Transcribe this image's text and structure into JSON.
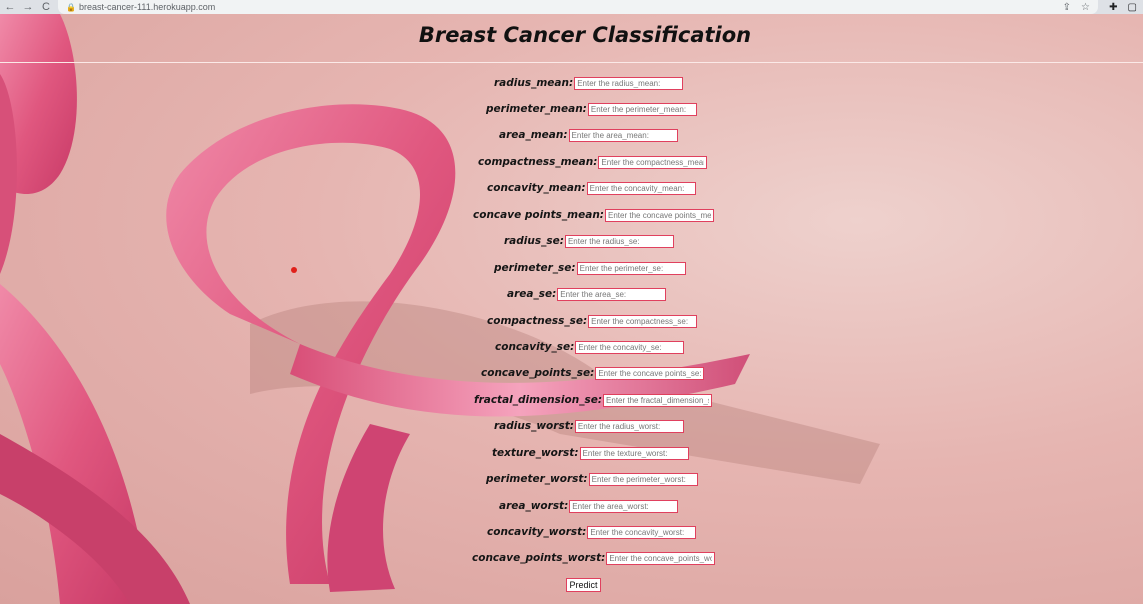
{
  "browser": {
    "url": "breast-cancer-111.herokuapp.com",
    "icons": {
      "back": "←",
      "forward": "→",
      "reload": "C",
      "lock": "🔒",
      "share": "⇪",
      "star": "☆",
      "extensions": "✚",
      "sidepanel": "▢"
    }
  },
  "page": {
    "title": "Breast Cancer Classification",
    "predict_label": "Predict",
    "fields": [
      {
        "label": "radius_mean:",
        "placeholder": "Enter the radius_mean:"
      },
      {
        "label": "perimeter_mean:",
        "placeholder": "Enter the perimeter_mean:"
      },
      {
        "label": "area_mean:",
        "placeholder": "Enter the area_mean:"
      },
      {
        "label": "compactness_mean:",
        "placeholder": "Enter the compactness_mean:"
      },
      {
        "label": "concavity_mean:",
        "placeholder": "Enter the concavity_mean:"
      },
      {
        "label": "concave points_mean:",
        "placeholder": "Enter the concave points_mean:"
      },
      {
        "label": "radius_se:",
        "placeholder": "Enter the radius_se:"
      },
      {
        "label": "perimeter_se:",
        "placeholder": "Enter the perimeter_se:"
      },
      {
        "label": "area_se:",
        "placeholder": "Enter the area_se:"
      },
      {
        "label": "compactness_se:",
        "placeholder": "Enter the compactness_se:"
      },
      {
        "label": "concavity_se:",
        "placeholder": "Enter the concavity_se:"
      },
      {
        "label": "concave_points_se:",
        "placeholder": "Enter the concave points_se:"
      },
      {
        "label": "fractal_dimension_se:",
        "placeholder": "Enter the fractal_dimension_se:"
      },
      {
        "label": "radius_worst:",
        "placeholder": "Enter the radius_worst:"
      },
      {
        "label": "texture_worst:",
        "placeholder": "Enter the texture_worst:"
      },
      {
        "label": "perimeter_worst:",
        "placeholder": "Enter the perimeter_worst:"
      },
      {
        "label": "area_worst:",
        "placeholder": "Enter the area_worst:"
      },
      {
        "label": "concavity_worst:",
        "placeholder": "Enter the concavity_worst:"
      },
      {
        "label": "concave_points_worst:",
        "placeholder": "Enter the concave_points_worst:"
      }
    ]
  },
  "colors": {
    "accent": "#e0405e",
    "ribbon": "#e0577f",
    "background": "#e8b9b6"
  }
}
